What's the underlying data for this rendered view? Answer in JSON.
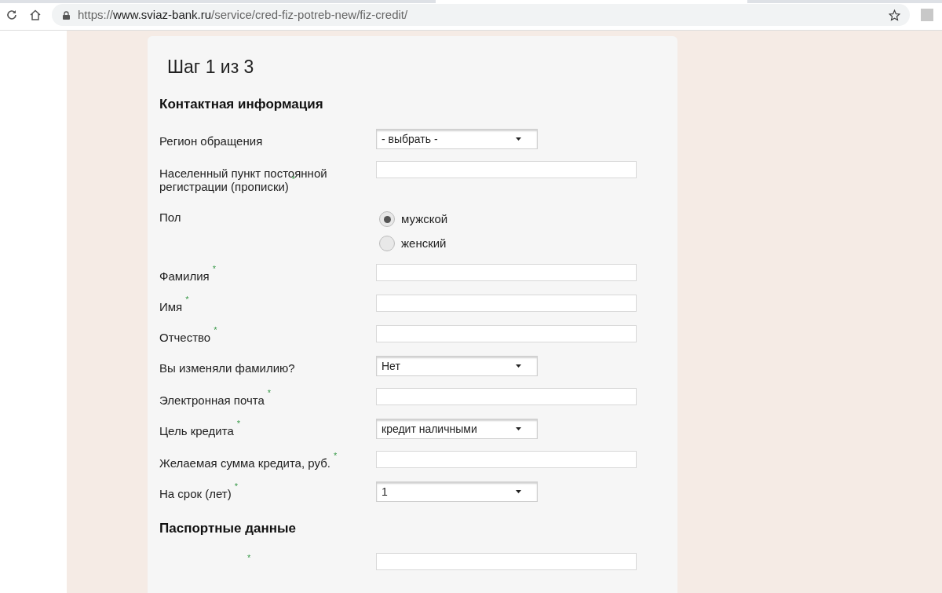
{
  "address_bar": {
    "scheme": "https://",
    "host": "www.sviaz-bank.ru",
    "path": "/service/cred-fiz-potreb-new/fiz-credit/"
  },
  "form": {
    "step_title": "Шаг 1 из 3",
    "sections": [
      {
        "heading": "Контактная информация",
        "fields": [
          {
            "kind": "select",
            "label": "Регион обращения",
            "value": "- выбрать -"
          },
          {
            "kind": "text",
            "label": "Населенный пункт постоянной регистрации (прописки)",
            "required_mark": "*"
          },
          {
            "kind": "radio",
            "label": "Пол",
            "options": [
              {
                "label": "мужской",
                "selected": true
              },
              {
                "label": "женский",
                "selected": false
              }
            ]
          },
          {
            "kind": "text",
            "label": "Фамилия",
            "required_mark": "*"
          },
          {
            "kind": "text",
            "label": "Имя",
            "required_mark": "*"
          },
          {
            "kind": "text",
            "label": "Отчество",
            "required_mark": "*"
          },
          {
            "kind": "select",
            "label": "Вы изменяли фамилию?",
            "value": "Нет"
          },
          {
            "kind": "text",
            "label": "Электронная почта",
            "required_mark": "*"
          },
          {
            "kind": "select",
            "label": "Цель кредита",
            "required_mark": "*",
            "value": "кредит наличными"
          },
          {
            "kind": "text",
            "label": "Желаемая сумма кредита, руб.",
            "required_mark": "*"
          },
          {
            "kind": "select",
            "label": "На срок (лет)",
            "required_mark": "*",
            "value": "1"
          }
        ]
      },
      {
        "heading": "Паспортные данные",
        "fields": [
          {
            "kind": "text",
            "required_mark": "*"
          }
        ]
      }
    ]
  }
}
